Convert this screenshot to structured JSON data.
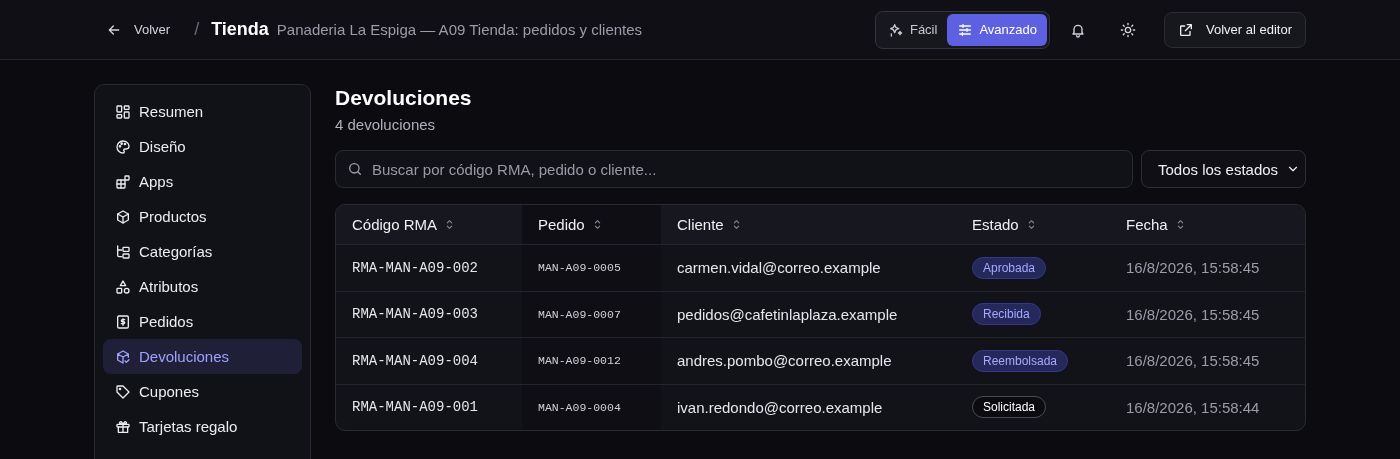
{
  "header": {
    "back": "Volver",
    "separator": "/",
    "title": "Tienda",
    "subtitle": "Panaderia La Espiga — A09 Tienda: pedidos y clientes",
    "modes": [
      {
        "label": "Fácil",
        "selected": false
      },
      {
        "label": "Avanzado",
        "selected": true
      }
    ],
    "editor_button": "Volver al editor"
  },
  "sidebar": {
    "items": [
      {
        "label": "Resumen",
        "selected": false
      },
      {
        "label": "Diseño",
        "selected": false
      },
      {
        "label": "Apps",
        "selected": false
      },
      {
        "label": "Productos",
        "selected": false
      },
      {
        "label": "Categorías",
        "selected": false
      },
      {
        "label": "Atributos",
        "selected": false
      },
      {
        "label": "Pedidos",
        "selected": false
      },
      {
        "label": "Devoluciones",
        "selected": true
      },
      {
        "label": "Cupones",
        "selected": false
      },
      {
        "label": "Tarjetas regalo",
        "selected": false
      }
    ]
  },
  "page": {
    "title": "Devoluciones",
    "count": "4 devoluciones"
  },
  "search": {
    "placeholder": "Buscar por código RMA, pedido o cliente..."
  },
  "status_filter": {
    "value": "Todos los estados"
  },
  "table": {
    "columns": [
      "Código RMA",
      "Pedido",
      "Cliente",
      "Estado",
      "Fecha"
    ],
    "rows": [
      {
        "rma": "RMA-MAN-A09-002",
        "order": "MAN-A09-0005",
        "customer": "carmen.vidal@correo.example",
        "status": {
          "label": "Aprobada",
          "color": "#25285a"
        },
        "date": "16/8/2026, 15:58:45"
      },
      {
        "rma": "RMA-MAN-A09-003",
        "order": "MAN-A09-0007",
        "customer": "pedidos@cafetinlaplaza.example",
        "status": {
          "label": "Recibida",
          "color": "#25285a"
        },
        "date": "16/8/2026, 15:58:45"
      },
      {
        "rma": "RMA-MAN-A09-004",
        "order": "MAN-A09-0012",
        "customer": "andres.pombo@correo.example",
        "status": {
          "label": "Reembolsada",
          "color": "#25285a"
        },
        "date": "16/8/2026, 15:58:45"
      },
      {
        "rma": "RMA-MAN-A09-001",
        "order": "MAN-A09-0004",
        "customer": "ivan.redondo@correo.example",
        "status": {
          "label": "Solicitada",
          "color": "#0b0b10"
        },
        "date": "16/8/2026, 15:58:44"
      }
    ]
  }
}
